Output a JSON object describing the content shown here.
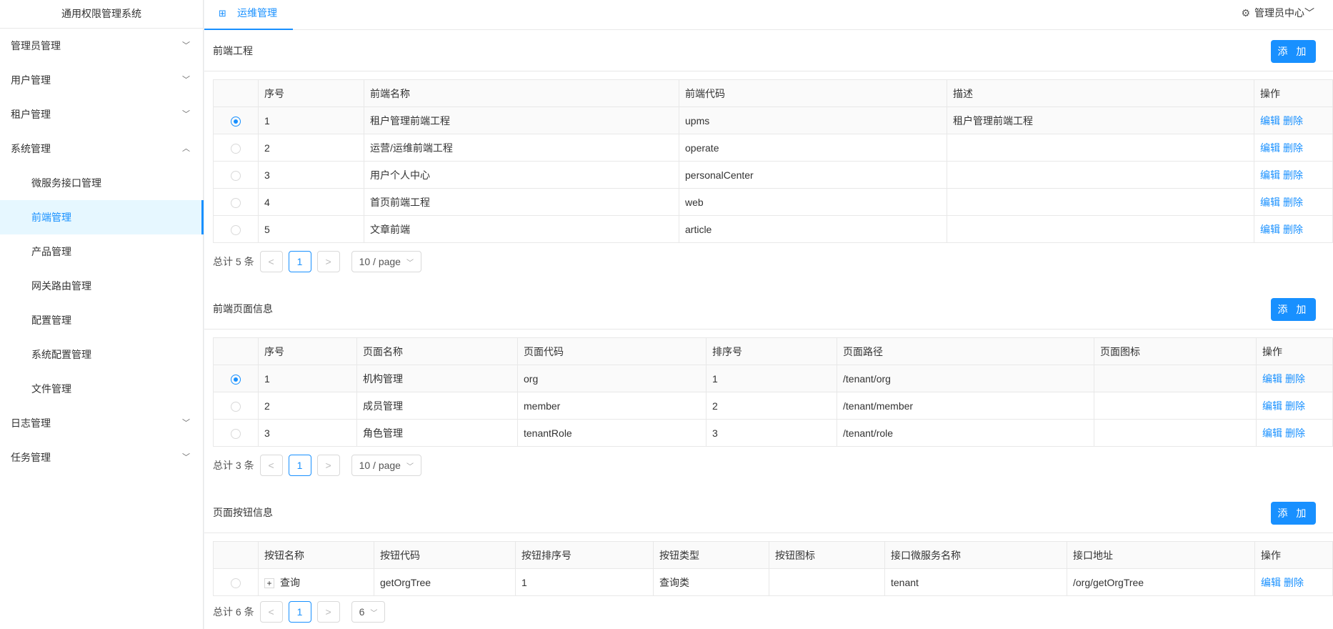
{
  "app_title": "通用权限管理系统",
  "sidebar": {
    "items": [
      {
        "label": "管理员管理",
        "type": "group",
        "chev": "﹀"
      },
      {
        "label": "用户管理",
        "type": "group",
        "chev": "﹀"
      },
      {
        "label": "租户管理",
        "type": "group",
        "chev": "﹀"
      },
      {
        "label": "系统管理",
        "type": "group",
        "chev": "︿"
      },
      {
        "label": "微服务接口管理",
        "type": "sub"
      },
      {
        "label": "前端管理",
        "type": "sub",
        "active": true
      },
      {
        "label": "产品管理",
        "type": "sub"
      },
      {
        "label": "网关路由管理",
        "type": "sub"
      },
      {
        "label": "配置管理",
        "type": "sub"
      },
      {
        "label": "系统配置管理",
        "type": "sub"
      },
      {
        "label": "文件管理",
        "type": "sub"
      },
      {
        "label": "日志管理",
        "type": "group",
        "chev": "﹀"
      },
      {
        "label": "任务管理",
        "type": "group",
        "chev": "﹀"
      }
    ]
  },
  "topbar": {
    "tab_label": "运维管理",
    "admin_label": "管理员中心"
  },
  "frontend_project": {
    "title": "前端工程",
    "add_label": "添 加",
    "columns": [
      "序号",
      "前端名称",
      "前端代码",
      "描述",
      "操作"
    ],
    "rows": [
      {
        "no": "1",
        "name": "租户管理前端工程",
        "code": "upms",
        "desc": "租户管理前端工程",
        "selected": true
      },
      {
        "no": "2",
        "name": "运营/运维前端工程",
        "code": "operate",
        "desc": ""
      },
      {
        "no": "3",
        "name": "用户个人中心",
        "code": "personalCenter",
        "desc": ""
      },
      {
        "no": "4",
        "name": "首页前端工程",
        "code": "web",
        "desc": ""
      },
      {
        "no": "5",
        "name": "文章前端",
        "code": "article",
        "desc": ""
      }
    ],
    "edit_label": "编辑",
    "delete_label": "删除",
    "pager": {
      "total": "总计 5 条",
      "prev": "<",
      "page": "1",
      "next": ">",
      "size": "10 / page"
    }
  },
  "page_info": {
    "title": "前端页面信息",
    "add_label": "添 加",
    "columns": [
      "序号",
      "页面名称",
      "页面代码",
      "排序号",
      "页面路径",
      "页面图标",
      "操作"
    ],
    "rows": [
      {
        "no": "1",
        "name": "机构管理",
        "code": "org",
        "order": "1",
        "path": "/tenant/org",
        "icon": "",
        "selected": true
      },
      {
        "no": "2",
        "name": "成员管理",
        "code": "member",
        "order": "2",
        "path": "/tenant/member",
        "icon": ""
      },
      {
        "no": "3",
        "name": "角色管理",
        "code": "tenantRole",
        "order": "3",
        "path": "/tenant/role",
        "icon": ""
      }
    ],
    "edit_label": "编辑",
    "delete_label": "删除",
    "pager": {
      "total": "总计 3 条",
      "prev": "<",
      "page": "1",
      "next": ">",
      "size": "10 / page"
    }
  },
  "button_info": {
    "title": "页面按钮信息",
    "add_label": "添 加",
    "columns": [
      "按钮名称",
      "按钮代码",
      "按钮排序号",
      "按钮类型",
      "按钮图标",
      "接口微服务名称",
      "接口地址",
      "操作"
    ],
    "rows": [
      {
        "expand": "+",
        "name": "查询",
        "code": "getOrgTree",
        "order": "1",
        "type": "查询类",
        "icon": "",
        "service": "tenant",
        "url": "/org/getOrgTree"
      }
    ],
    "edit_label": "编辑",
    "delete_label": "删除",
    "pager": {
      "total": "总计 6 条",
      "prev": "<",
      "page": "1",
      "next": ">",
      "size": "6"
    }
  },
  "colors": {
    "accent": "#1890ff",
    "active_bg": "#e6f7ff"
  }
}
